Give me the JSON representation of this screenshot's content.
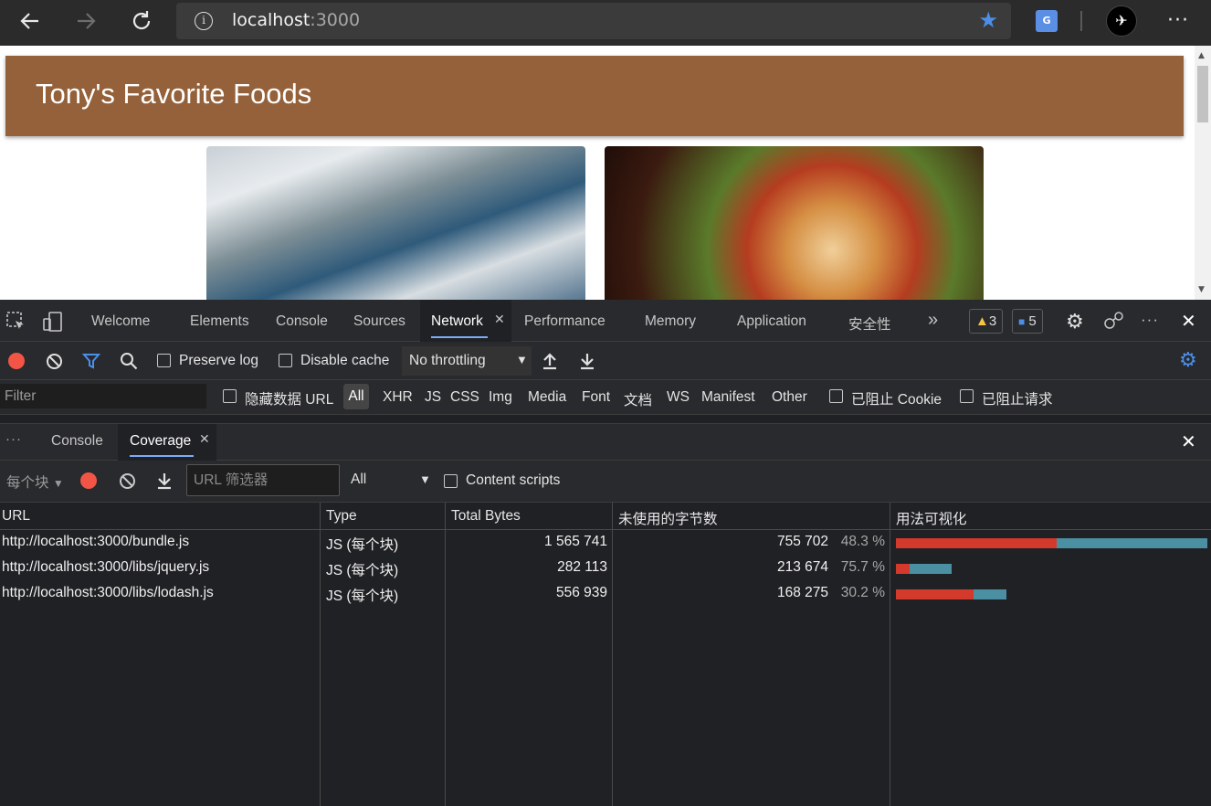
{
  "browser": {
    "url_host": "localhost",
    "url_port": ":3000",
    "back_icon": "arrow-left-icon",
    "forward_icon": "arrow-right-icon",
    "reload_icon": "reload-icon",
    "more_label": "···"
  },
  "page": {
    "title": "Tony's Favorite Foods",
    "cards": [
      {
        "name": "fish-photo"
      },
      {
        "name": "burrito-photo"
      }
    ]
  },
  "devtools": {
    "tabs": [
      "Welcome",
      "Elements",
      "Console",
      "Sources",
      "Network",
      "Performance",
      "Memory",
      "Application",
      "安全性"
    ],
    "active_tab": "Network",
    "more_tabs": "»",
    "warnings_count": "3",
    "messages_count": "5",
    "close": "✕",
    "network_toolbar": {
      "preserve_log": "Preserve log",
      "disable_cache": "Disable cache",
      "throttling": "No throttling"
    },
    "filter_row": {
      "filter_placeholder": "Filter",
      "hide_data_urls": "隐藏数据 URL",
      "types": [
        "All",
        "XHR",
        "JS",
        "CSS",
        "Img",
        "Media",
        "Font",
        "文档",
        "WS",
        "Manifest",
        "Other"
      ],
      "blocked_cookies": "已阻止 Cookie",
      "blocked_requests": "已阻止请求"
    },
    "drawer": {
      "more": "···",
      "tabs": [
        "Console",
        "Coverage"
      ],
      "active_tab": "Coverage"
    },
    "coverage_toolbar": {
      "granularity": "每个块",
      "url_filter_placeholder": "URL 筛选器",
      "type_select": "All",
      "content_scripts": "Content scripts"
    },
    "coverage_table": {
      "headers": [
        "URL",
        "Type",
        "Total Bytes",
        "未使用的字节数",
        "用法可视化"
      ],
      "rows": [
        {
          "url": "http://localhost:3000/bundle.js",
          "type": "JS (每个块)",
          "total": "1 565 741",
          "unused": "755 702",
          "pct": "48.3 %",
          "total_num": 1565741,
          "unused_num": 755702
        },
        {
          "url": "http://localhost:3000/libs/jquery.js",
          "type": "JS (每个块)",
          "total": "282 113",
          "unused": "213 674",
          "pct": "75.7 %",
          "total_num": 282113,
          "unused_num": 213674
        },
        {
          "url": "http://localhost:3000/libs/lodash.js",
          "type": "JS (每个块)",
          "total": "556 939",
          "unused": "168 275",
          "pct": "30.2 %",
          "total_num": 556939,
          "unused_num": 168275
        }
      ]
    },
    "colors": {
      "used_bar": "#d33a2c",
      "unused_bar": "#4b8fa3",
      "accent": "#7cacf8"
    }
  }
}
